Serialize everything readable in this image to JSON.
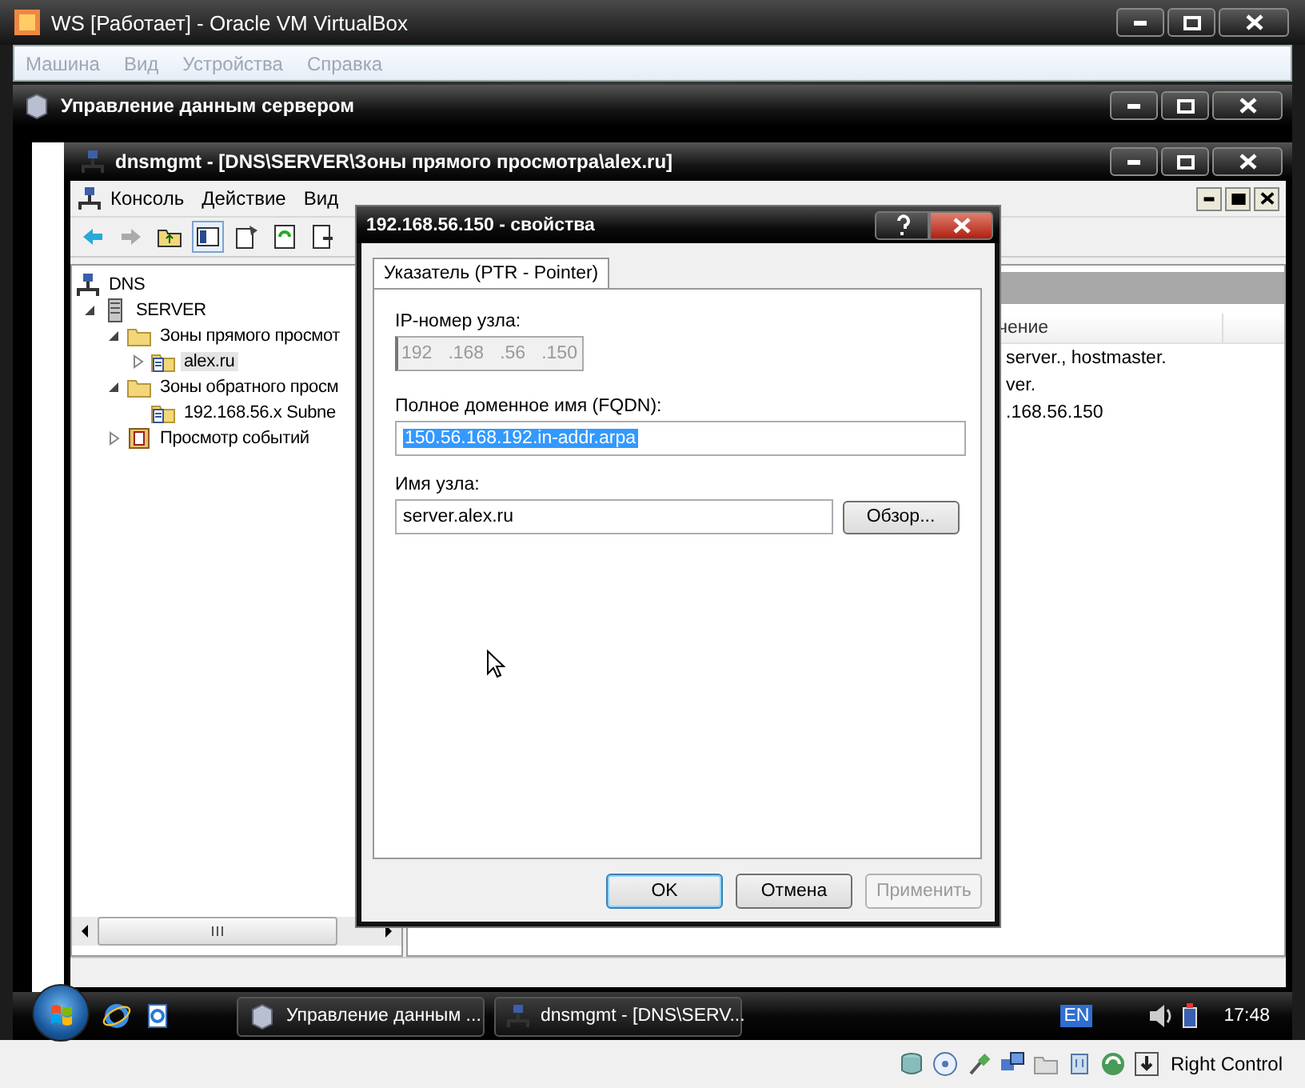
{
  "vbox": {
    "title": "WS [Работает] - Oracle VM VirtualBox",
    "menu": [
      {
        "label": "Машина",
        "disabled": true
      },
      {
        "label": "Вид",
        "disabled": true
      },
      {
        "label": "Устройства",
        "disabled": true
      },
      {
        "label": "Справка",
        "disabled": true
      }
    ],
    "host_key": "Right Control"
  },
  "server_manager": {
    "title": "Управление данным сервером"
  },
  "mmc": {
    "title": "dnsmgmt - [DNS\\SERVER\\Зоны прямого просмотра\\alex.ru]",
    "menu": [
      "Консоль",
      "Действие",
      "Вид"
    ],
    "tree": [
      {
        "label": "DNS",
        "kind": "dns",
        "selected": false,
        "children": [
          {
            "label": "SERVER",
            "kind": "server",
            "expanded": true,
            "selected": false,
            "children": [
              {
                "label": "Зоны прямого просмот",
                "kind": "folder",
                "expanded": true,
                "selected": false,
                "children": [
                  {
                    "label": "alex.ru",
                    "kind": "zone",
                    "expanded": false,
                    "selected": true
                  }
                ]
              },
              {
                "label": "Зоны обратного просм",
                "kind": "folder",
                "expanded": true,
                "selected": false,
                "children": [
                  {
                    "label": "192.168.56.x Subne",
                    "kind": "zone",
                    "selected": false
                  }
                ]
              },
              {
                "label": "Просмотр событий",
                "kind": "events",
                "expanded": false,
                "selected": false
              }
            ]
          }
        ]
      }
    ],
    "list": {
      "columns": [
        "чение"
      ],
      "rows": [
        "server., hostmaster.",
        "ver.",
        ".168.56.150"
      ]
    }
  },
  "dialog": {
    "title": "192.168.56.150 - свойства",
    "tabs": [
      {
        "label": "Указатель (PTR - Pointer)",
        "selected": true
      }
    ],
    "ip_label": "IP-номер узла:",
    "ip_octets": [
      "192",
      ".168",
      ".56",
      ".150"
    ],
    "ip_disabled": true,
    "fqdn_label": "Полное доменное имя (FQDN):",
    "fqdn_value": "150.56.168.192.in-addr.arpa",
    "fqdn_selected": true,
    "host_label": "Имя узла:",
    "host_value": "server.alex.ru",
    "browse_button": "Обзор...",
    "buttons": [
      {
        "label": "OK",
        "default": true,
        "disabled": false
      },
      {
        "label": "Отмена",
        "default": false,
        "disabled": false
      },
      {
        "label": "Применить",
        "default": false,
        "disabled": true
      }
    ]
  },
  "taskbar": {
    "tasks": [
      {
        "label": "Управление данным ...",
        "kind": "server"
      },
      {
        "label": "dnsmgmt - [DNS\\SERV...",
        "kind": "network"
      }
    ],
    "language": "EN",
    "clock": "17:48"
  }
}
